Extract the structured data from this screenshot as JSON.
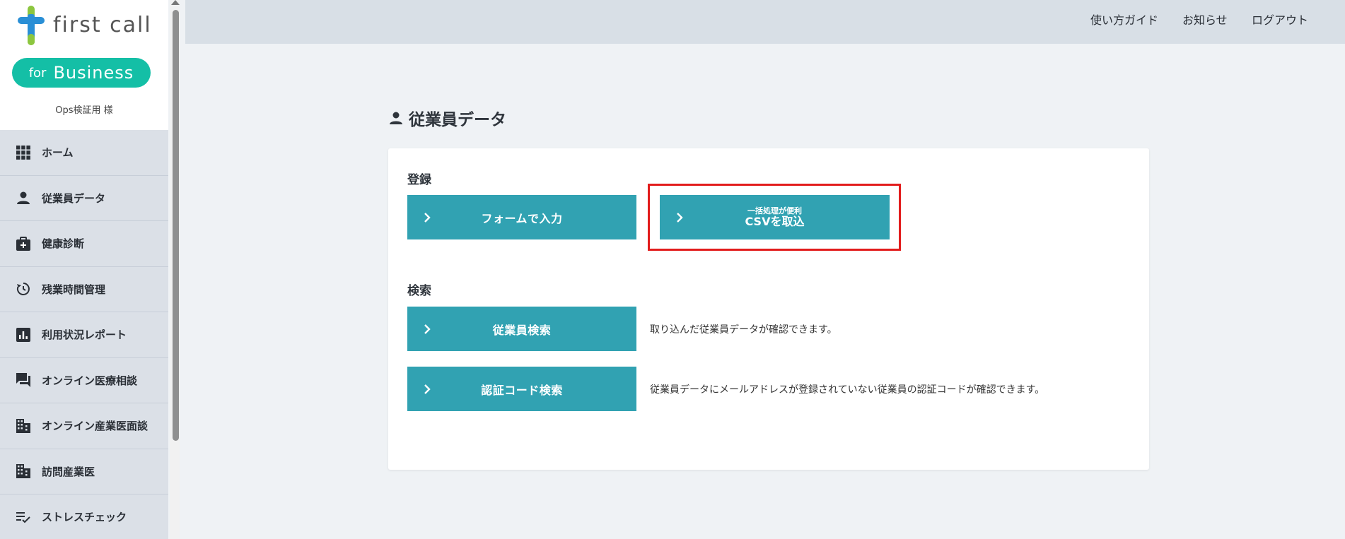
{
  "brand": {
    "logo_text": "first call",
    "pill_for": "for",
    "pill_name": "Business",
    "company": "Ops検証用 様"
  },
  "sidebar": {
    "items": [
      {
        "label": "ホーム",
        "icon": "grid-icon"
      },
      {
        "label": "従業員データ",
        "icon": "person-icon"
      },
      {
        "label": "健康診断",
        "icon": "medical-bag-icon"
      },
      {
        "label": "残業時間管理",
        "icon": "history-icon"
      },
      {
        "label": "利用状況レポート",
        "icon": "bar-chart-icon"
      },
      {
        "label": "オンライン医療相談",
        "icon": "chat-icon"
      },
      {
        "label": "オンライン産業医面談",
        "icon": "building-icon"
      },
      {
        "label": "訪問産業医",
        "icon": "building-icon"
      },
      {
        "label": "ストレスチェック",
        "icon": "checklist-icon"
      }
    ]
  },
  "header": {
    "guide": "使い方ガイド",
    "news": "お知らせ",
    "logout": "ログアウト"
  },
  "page": {
    "title": "従業員データ"
  },
  "register": {
    "label": "登録",
    "form_button": "フォームで入力",
    "csv_sub": "一括処理が便利",
    "csv_main": "CSVを取込"
  },
  "search": {
    "label": "検索",
    "employee_button": "従業員検索",
    "employee_desc": "取り込んだ従業員データが確認できます。",
    "auth_button": "認証コード検索",
    "auth_desc": "従業員データにメールアドレスが登録されていない従業員の認証コードが確認できます。"
  },
  "colors": {
    "accent": "#31a2b2",
    "brand_green": "#14bfa6",
    "highlight": "#e21c1c",
    "sidebar_bg": "#dbe0e7",
    "header_bg": "#d8dfe6"
  }
}
